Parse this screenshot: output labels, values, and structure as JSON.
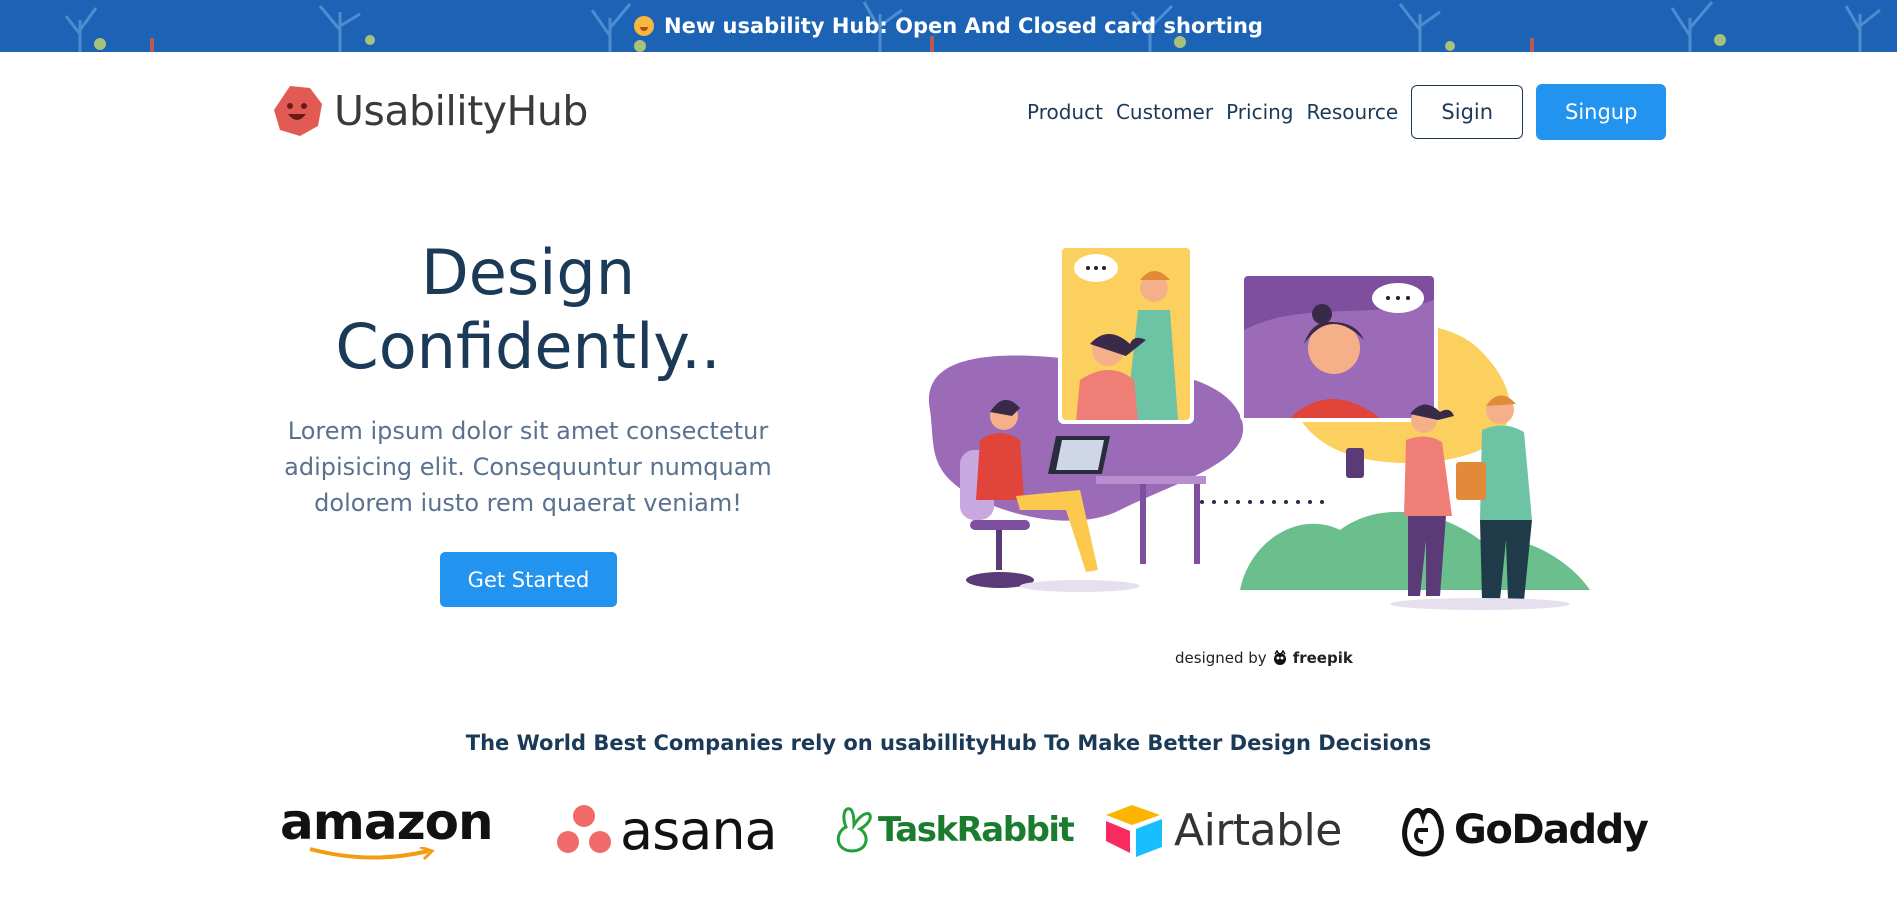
{
  "announcement": {
    "text": "New usability Hub: Open And Closed card shorting",
    "emoji_icon": "party-face-icon"
  },
  "brand": {
    "name": "UsabilityHub",
    "logo_color": "#e25a54"
  },
  "nav": {
    "links": [
      "Product",
      "Customer",
      "Pricing",
      "Resource"
    ],
    "signin_label": "Sigin",
    "signup_label": "Singup"
  },
  "hero": {
    "title_line1": "Design",
    "title_line2": "Confidently..",
    "description": "Lorem ipsum dolor sit amet consectetur adipisicing elit. Consequuntur numquam dolorem iusto rem quaerat veniam!",
    "cta_label": "Get Started",
    "credit_prefix": "designed by",
    "credit_brand": "freepik"
  },
  "companies": {
    "heading": "The World Best Companies rely on usabillityHub To Make Better Design Decisions",
    "logos": [
      "amazon",
      "asana",
      "TaskRabbit",
      "Airtable",
      "GoDaddy"
    ]
  },
  "colors": {
    "accent": "#2293ee",
    "navy": "#1b3a57",
    "banner": "#1d63b5"
  }
}
